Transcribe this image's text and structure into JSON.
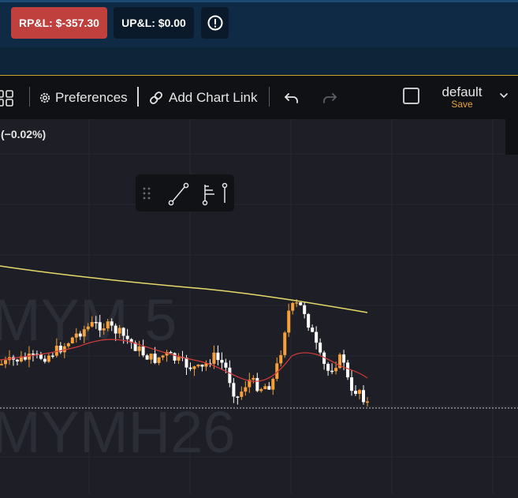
{
  "header": {
    "realized_pnl": "RP&L: $-357.30",
    "unrealized_pnl": "UP&L: $0.00",
    "rpl_color": "#c0403d"
  },
  "toolbar": {
    "layout_icon": "grid-icon",
    "preferences_label": "Preferences",
    "add_chart_link_label": "Add Chart Link",
    "undo_icon": "undo-icon",
    "redo_icon": "redo-icon",
    "layout_name": "default",
    "save_label": "Save",
    "accent_color": "#e8a23a"
  },
  "chart": {
    "change_text": "(−0.02%)",
    "watermark_top": "MYM 5",
    "watermark_bottom": "MYMH26",
    "up_color": "#f5a03a",
    "down_color": "#ffffff",
    "ma_slow_color": "#e8d96a",
    "ma_fast_color": "#d33a3a"
  },
  "drawing_toolbar": {
    "tools": [
      "drag-handle-icon",
      "trend-line-icon",
      "fib-tool-icon",
      "vertical-line-icon"
    ]
  }
}
